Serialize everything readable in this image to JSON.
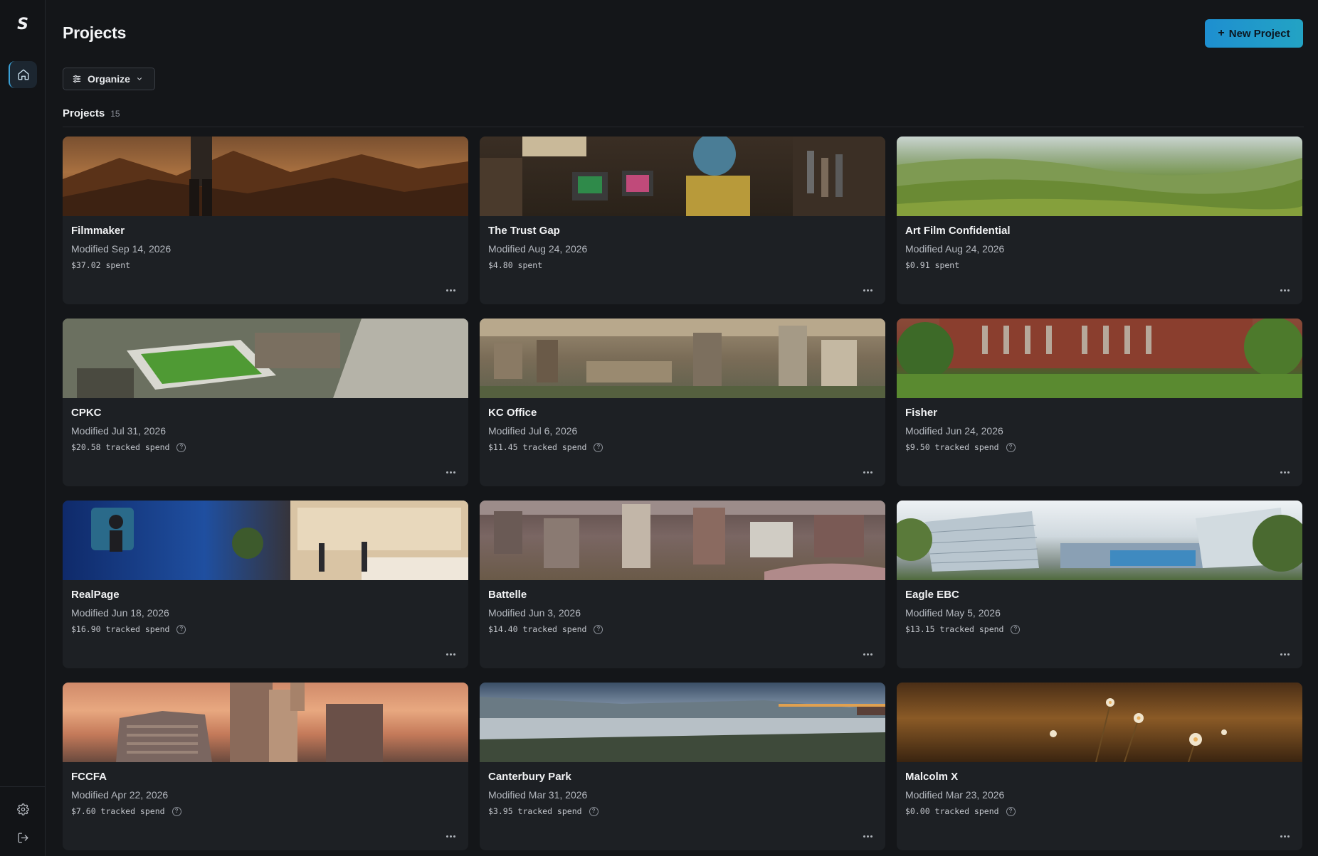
{
  "sidebar": {
    "logo_text": "S",
    "items": [
      {
        "name": "home",
        "icon": "home-icon"
      }
    ],
    "bottom": [
      {
        "name": "settings",
        "icon": "gear-icon"
      },
      {
        "name": "logout",
        "icon": "logout-icon"
      }
    ]
  },
  "header": {
    "title": "Projects",
    "new_project_label": "New Project"
  },
  "toolbar": {
    "organize_label": "Organize"
  },
  "section": {
    "title": "Projects",
    "count": "15"
  },
  "colors": {
    "accent": "#1e8fd0",
    "background": "#141619",
    "card": "#1d2024"
  },
  "projects": [
    {
      "name": "Filmmaker",
      "modified": "Modified Sep 14, 2026",
      "spend": "$37.02 spent",
      "has_help": false
    },
    {
      "name": "The Trust Gap",
      "modified": "Modified Aug 24, 2026",
      "spend": "$4.80 spent",
      "has_help": false
    },
    {
      "name": "Art Film Confidential",
      "modified": "Modified Aug 24, 2026",
      "spend": "$0.91 spent",
      "has_help": false
    },
    {
      "name": "CPKC",
      "modified": "Modified Jul 31, 2026",
      "spend": "$20.58 tracked spend",
      "has_help": true
    },
    {
      "name": "KC Office",
      "modified": "Modified Jul 6, 2026",
      "spend": "$11.45 tracked spend",
      "has_help": true
    },
    {
      "name": "Fisher",
      "modified": "Modified Jun 24, 2026",
      "spend": "$9.50 tracked spend",
      "has_help": true
    },
    {
      "name": "RealPage",
      "modified": "Modified Jun 18, 2026",
      "spend": "$16.90 tracked spend",
      "has_help": true
    },
    {
      "name": "Battelle",
      "modified": "Modified Jun 3, 2026",
      "spend": "$14.40 tracked spend",
      "has_help": true
    },
    {
      "name": "Eagle EBC",
      "modified": "Modified May 5, 2026",
      "spend": "$13.15 tracked spend",
      "has_help": true
    },
    {
      "name": "FCCFA",
      "modified": "Modified Apr 22, 2026",
      "spend": "$7.60 tracked spend",
      "has_help": true
    },
    {
      "name": "Canterbury Park",
      "modified": "Modified Mar 31, 2026",
      "spend": "$3.95 tracked spend",
      "has_help": true
    },
    {
      "name": "Malcolm X",
      "modified": "Modified Mar 23, 2026",
      "spend": "$0.00 tracked spend",
      "has_help": true
    }
  ]
}
